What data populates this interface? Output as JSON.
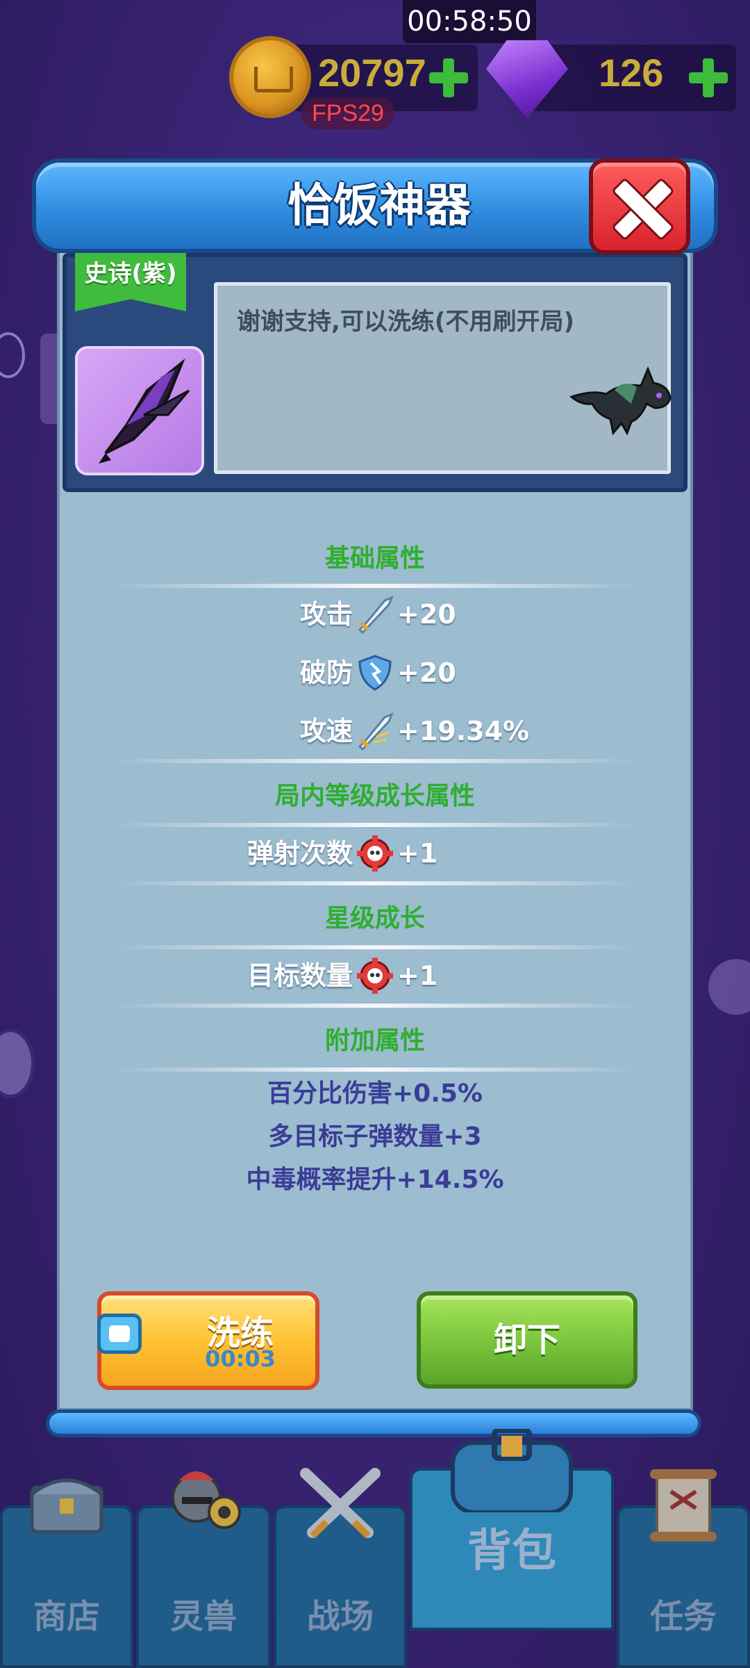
{
  "status": {
    "clock": "00:58:50",
    "fps": "FPS29"
  },
  "resources": {
    "coins": "20797",
    "gems": "126"
  },
  "modal": {
    "title": "恰饭神器",
    "rarity": "史诗(紫)",
    "description": "谢谢支持,可以洗练(不用刷开局)",
    "sections": {
      "base": "基础属性",
      "level_growth": "局内等级成长属性",
      "star_growth": "星级成长",
      "extra": "附加属性"
    },
    "stats": {
      "attack": {
        "label": "攻击",
        "value": "+20",
        "icon": "sword-icon"
      },
      "armor_pierce": {
        "label": "破防",
        "value": "+20",
        "icon": "shield-icon"
      },
      "attack_speed": {
        "label": "攻速",
        "value": "+19.34%",
        "icon": "swift-sword-icon"
      },
      "bounce": {
        "label": "弹射次数",
        "value": "+1",
        "icon": "target-skull-icon"
      },
      "targets": {
        "label": "目标数量",
        "value": "+1",
        "icon": "target-skull-icon"
      }
    },
    "extra_stats": [
      "百分比伤害+0.5%",
      "多目标子弹数量+3",
      "中毒概率提升+14.5%"
    ],
    "buttons": {
      "refine": "洗练",
      "refine_timer": "00:03",
      "unequip": "卸下"
    }
  },
  "nav": {
    "shop": "商店",
    "pets": "灵兽",
    "battle": "战场",
    "bag": "背包",
    "tasks": "任务"
  },
  "colors": {
    "section_green": "#2fae2f",
    "extra_blue": "#3a3c96",
    "modal_bg": "#9cbcd0"
  }
}
